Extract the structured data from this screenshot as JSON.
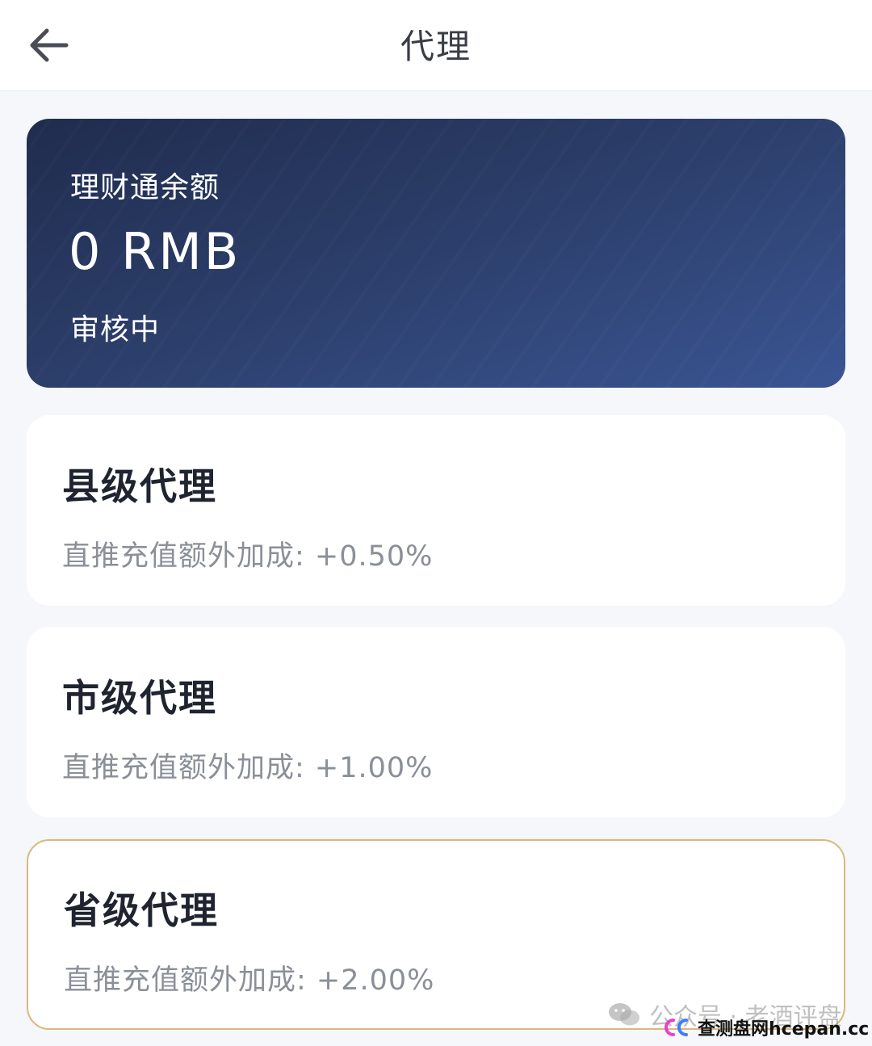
{
  "header": {
    "title": "代理"
  },
  "balance": {
    "label": "理财通余额",
    "amount": "0 RMB",
    "status": "审核中"
  },
  "agents": [
    {
      "name": "县级代理",
      "bonus": "直推充值额外加成: +0.50%"
    },
    {
      "name": "市级代理",
      "bonus": "直推充值额外加成: +1.00%"
    },
    {
      "name": "省级代理",
      "bonus": "直推充值额外加成: +2.00%"
    }
  ],
  "watermark": {
    "text": "公众号 · 老酒评盘",
    "site": "查测盘网hcepan.cc"
  },
  "colors": {
    "card_gradient_start": "#202c4e",
    "card_gradient_end": "#3a5593",
    "selected_border": "#d9b97a",
    "page_background": "#f5f7fa"
  },
  "icons": {
    "back": "arrow-left-icon",
    "watermark": "wechat-icon"
  }
}
